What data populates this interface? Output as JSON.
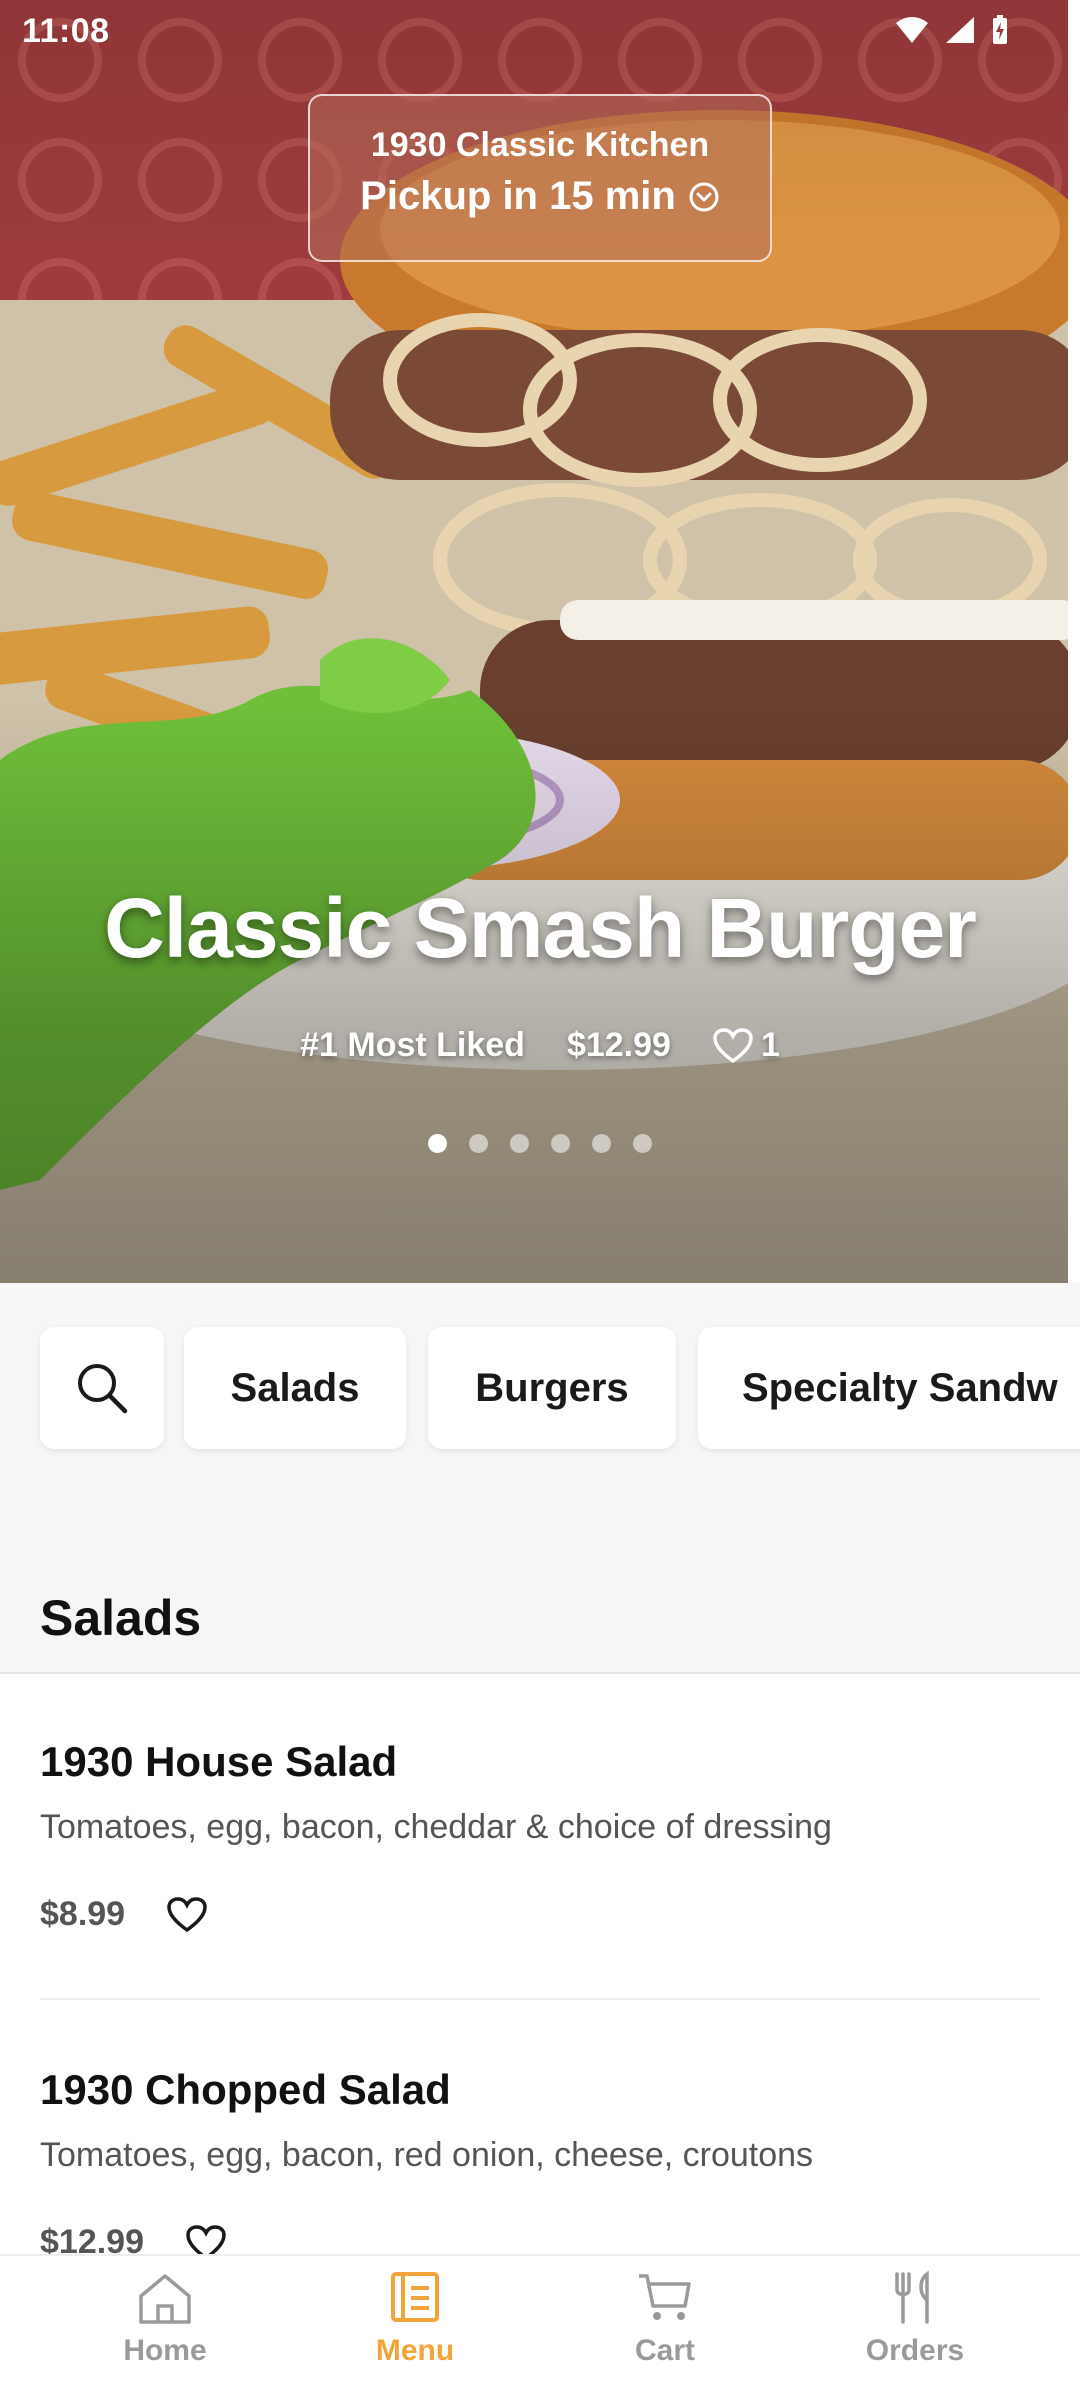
{
  "status_bar": {
    "time": "11:08"
  },
  "pickup": {
    "restaurant": "1930 Classic Kitchen",
    "time_label": "Pickup in 15 min"
  },
  "featured": {
    "title": "Classic Smash Burger",
    "badge": "#1 Most Liked",
    "price": "$12.99",
    "likes": "1",
    "carousel_total": 6,
    "carousel_active": 1
  },
  "categories": [
    "Salads",
    "Burgers",
    "Specialty Sandw"
  ],
  "section": {
    "title": "Salads"
  },
  "items": [
    {
      "name": "1930 House Salad",
      "description": "Tomatoes, egg, bacon, cheddar & choice of dressing",
      "price": "$8.99"
    },
    {
      "name": "1930 Chopped Salad",
      "description": "Tomatoes, egg, bacon, red onion, cheese, croutons",
      "price": "$12.99"
    }
  ],
  "nav": [
    {
      "label": "Home",
      "icon": "home-icon"
    },
    {
      "label": "Menu",
      "icon": "menu-icon"
    },
    {
      "label": "Cart",
      "icon": "cart-icon"
    },
    {
      "label": "Orders",
      "icon": "orders-icon"
    }
  ],
  "colors": {
    "accent": "#f2a33a",
    "inactive": "#9a9a9a"
  }
}
